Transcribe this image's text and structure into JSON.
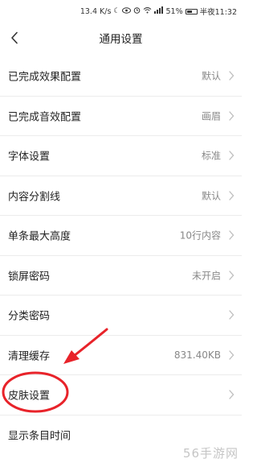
{
  "status_bar": {
    "net_speed": "13.4 K/s",
    "battery": "51%",
    "battery_level": 0.51,
    "time": "半夜11:32",
    "icons": [
      "moon-icon",
      "eye-icon",
      "alarm-icon",
      "wifi-icon",
      "signal-icon",
      "battery-icon"
    ]
  },
  "nav": {
    "title": "通用设置",
    "back_icon": "chevron-left-icon"
  },
  "settings": [
    {
      "label": "已完成效果配置",
      "value": "默认"
    },
    {
      "label": "已完成音效配置",
      "value": "画眉"
    },
    {
      "label": "字体设置",
      "value": "标准"
    },
    {
      "label": "内容分割线",
      "value": "默认"
    },
    {
      "label": "单条最大高度",
      "value": "10行内容"
    },
    {
      "label": "锁屏密码",
      "value": "未开启"
    },
    {
      "label": "分类密码",
      "value": ""
    },
    {
      "label": "清理缓存",
      "value": "831.40KB"
    },
    {
      "label": "皮肤设置",
      "value": ""
    },
    {
      "label": "显示条目时间",
      "value": ""
    }
  ],
  "annotation": {
    "color": "#e8232a",
    "highlighted_item": "皮肤设置"
  },
  "watermark": "56手游网"
}
